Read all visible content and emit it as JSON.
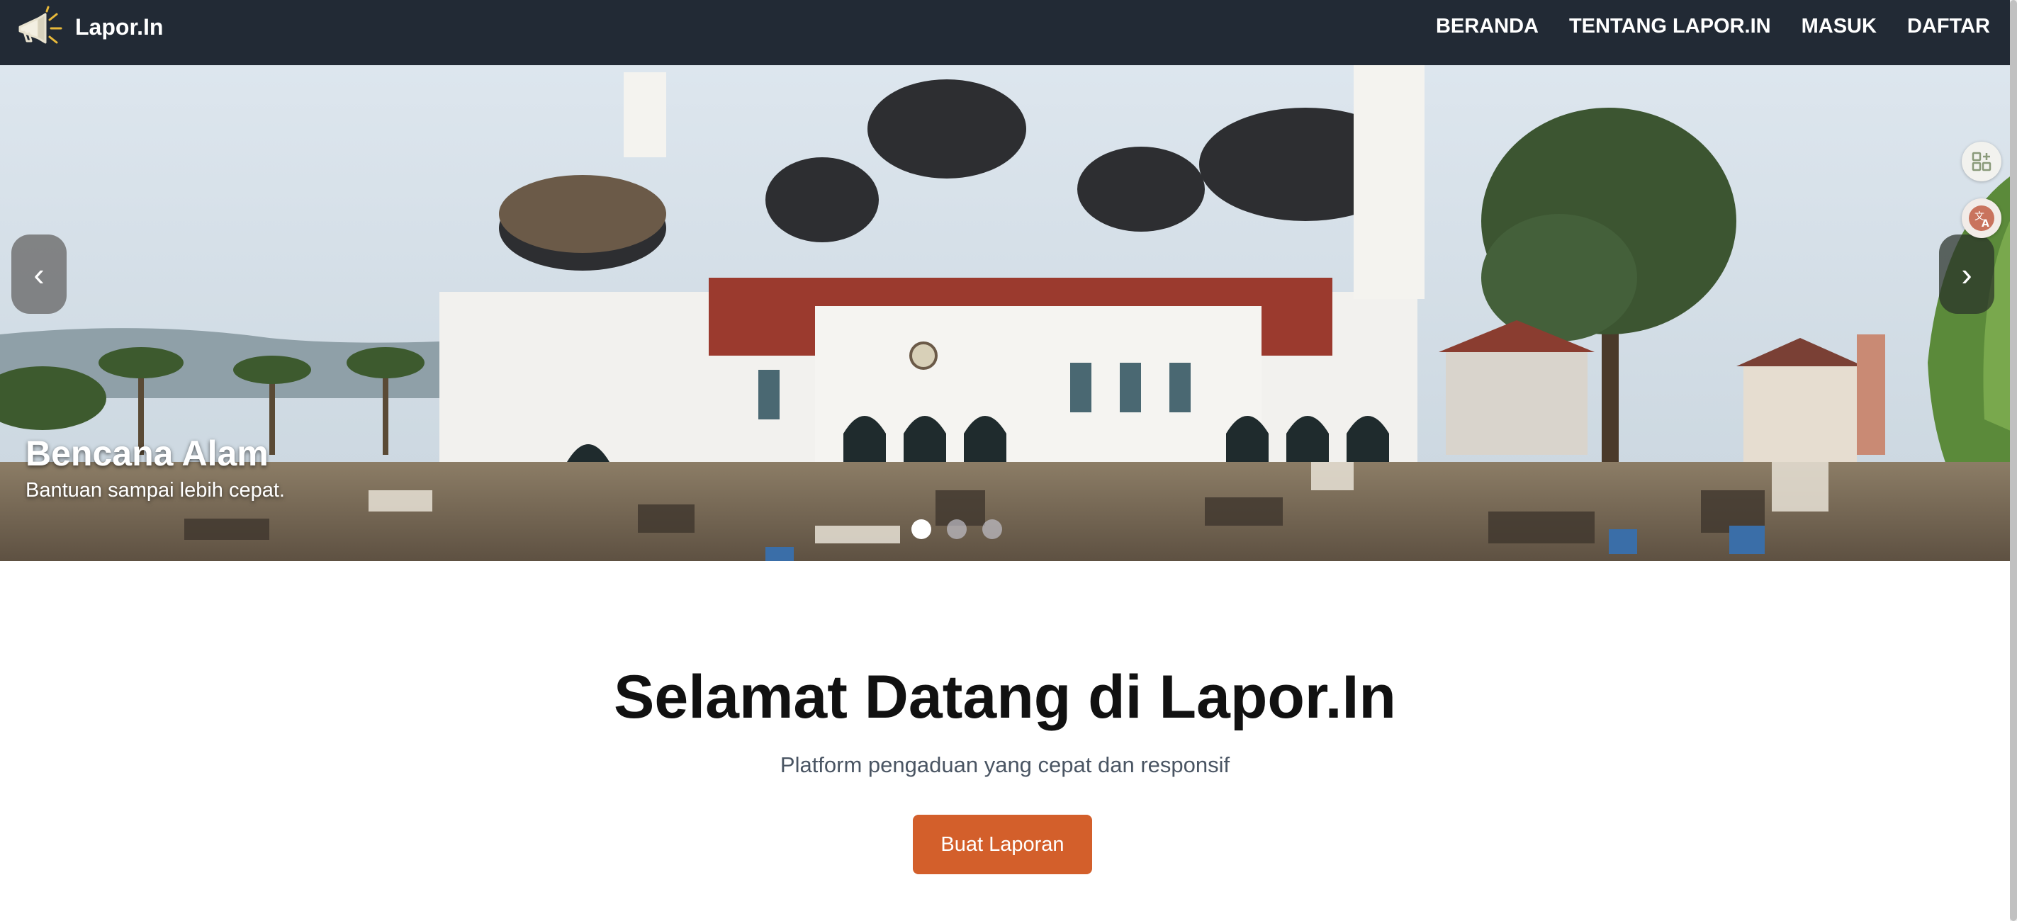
{
  "brand": {
    "name": "Lapor.In",
    "logo_icon": "megaphone-icon"
  },
  "nav": {
    "items": [
      {
        "label": "BERANDA"
      },
      {
        "label": "TENTANG LAPOR.IN"
      },
      {
        "label": "MASUK"
      },
      {
        "label": "DAFTAR"
      }
    ]
  },
  "hero": {
    "caption_title": "Bencana Alam",
    "caption_subtitle": "Bantuan sampai lebih cepat.",
    "prev_symbol": "‹",
    "next_symbol": "›",
    "slide_count": 3,
    "active_slide": 1,
    "image_subject": "mosque-disaster-photo"
  },
  "welcome": {
    "title": "Selamat Datang di Lapor.In",
    "subtitle": "Platform pengaduan yang cepat dan responsif",
    "cta_label": "Buat Laporan"
  },
  "side_tools": [
    {
      "icon": "apps-add-icon"
    },
    {
      "icon": "translate-icon"
    }
  ],
  "colors": {
    "navbar": "#222a35",
    "cta": "#d35f2b",
    "subtitle_text": "#4a5563"
  }
}
